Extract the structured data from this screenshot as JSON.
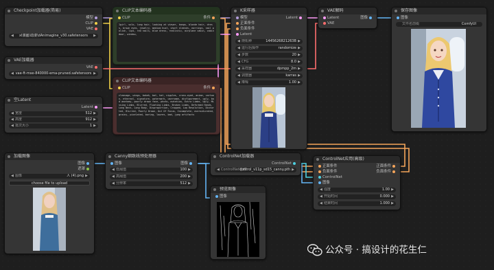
{
  "colors": {
    "clip": "#f2d24a",
    "model": "#b39ddb",
    "conditioning": "#f6a55a",
    "latent": "#ff9cf9",
    "vae": "#ff6e6e",
    "image": "#64b5f6",
    "control": "#4dd0e1"
  },
  "checkpoint": {
    "title": "Checkpoint加载器(简易)",
    "out_model": "模型",
    "out_clip": "CLIP",
    "out_vae": "VAE",
    "ckpt": "xl漫画\\动漫\\dAnimagine_v30.safetensors"
  },
  "vae_loader": {
    "title": "VAE加载器",
    "out_vae": "VAE",
    "vae_name": "vae-ft-mse-840000-ema-pruned.safetensors"
  },
  "empty_latent": {
    "title": "空Latent",
    "out": "Latent",
    "width_label": "宽度",
    "width": "512",
    "height_label": "高度",
    "height": "912",
    "batch_label": "批次大小",
    "batch": "1"
  },
  "clip_pos": {
    "title": "CLIP文本编码器",
    "in": "CLIP",
    "out": "条件",
    "text": "1girl, solo, long hair, looking at viewer, bangs, blonde hair, dress, brown eyes, jewelry, medium hust, short sleeves, earrings, nail polish, lips, red nails, blue dress, realistic, airplane cabin, cabin door, window,"
  },
  "clip_neg": {
    "title": "CLIP文本编码器",
    "in": "CLIP",
    "out": "条件",
    "text": "cleavage, wings, bokeh, bat, hat, nipples, cross-eyed, anime, cartoon, ethereal, signature, watermark, username, disfigurement, ugly, bad anatomy, poorly drawn face, photo, mutation, Extra Limbs, Ugly, Missing Limbs, Blurred, Floating Limbs, Broken Limbs, Deformed Hands, Long Neck, Long Body, Disproportion, Cropped, Low Resolution, Distorted, Blurred, Poorly Drawn, Out Of Focus, Incomplete, oversaturated, grainy, pixelated, boring, lowres, bad, jpeg artifacts"
  },
  "ksampler": {
    "title": "K采样器",
    "in_model": "模型",
    "in_pos": "正面条件",
    "in_neg": "负面条件",
    "in_latent": "Latent",
    "out": "Latent",
    "seed_label": "随机种",
    "seed": "1445626821263B",
    "control_label": "运行后操作",
    "control": "randomize",
    "steps_label": "步数",
    "steps": "20",
    "cfg_label": "CFG",
    "cfg": "8.0",
    "sampler_label": "采样器",
    "sampler": "dpmpp_2m",
    "scheduler_label": "调度器",
    "scheduler": "karras",
    "denoise_label": "降噪",
    "denoise": "1.00"
  },
  "vae_decode": {
    "title": "VAE解码",
    "in_latent": "Latent",
    "in_vae": "VAE",
    "out": "图像"
  },
  "save_image": {
    "title": "保存图像",
    "in": "图像",
    "prefix_label": "文件名前缀",
    "prefix": "ComfyUI"
  },
  "load_image": {
    "title": "加载图像",
    "out_image": "图像",
    "out_mask": "遮罩",
    "image_label": "图像",
    "image": "人 (4).png",
    "upload": "choose file to upload"
  },
  "canny": {
    "title": "Canny细致线预处理器",
    "in": "图像",
    "out": "图像",
    "low_label": "低阈值",
    "low": "100",
    "high_label": "高阈值",
    "high": "200",
    "res_label": "分辨率",
    "res": "512"
  },
  "cn_loader": {
    "title": "ControlNet加载器",
    "out": "ControlNet",
    "name_label": "ControlNet名称",
    "name": "control_v11p_sd15_canny.pth"
  },
  "preview": {
    "title": "预览图像",
    "in": "图像"
  },
  "cn_apply": {
    "title": "ControlNet应用(高级)",
    "in_pos": "正面条件",
    "in_neg": "负面条件",
    "in_cn": "ControlNet",
    "in_image": "图像",
    "out_pos": "正面条件",
    "out_neg": "负面条件",
    "strength_label": "强度",
    "strength": "1.00",
    "start_label": "开始时间",
    "start": "0.000",
    "end_label": "结束时间",
    "end": "1.000"
  },
  "watermark": "公众号 · 搞设计的花生仁"
}
